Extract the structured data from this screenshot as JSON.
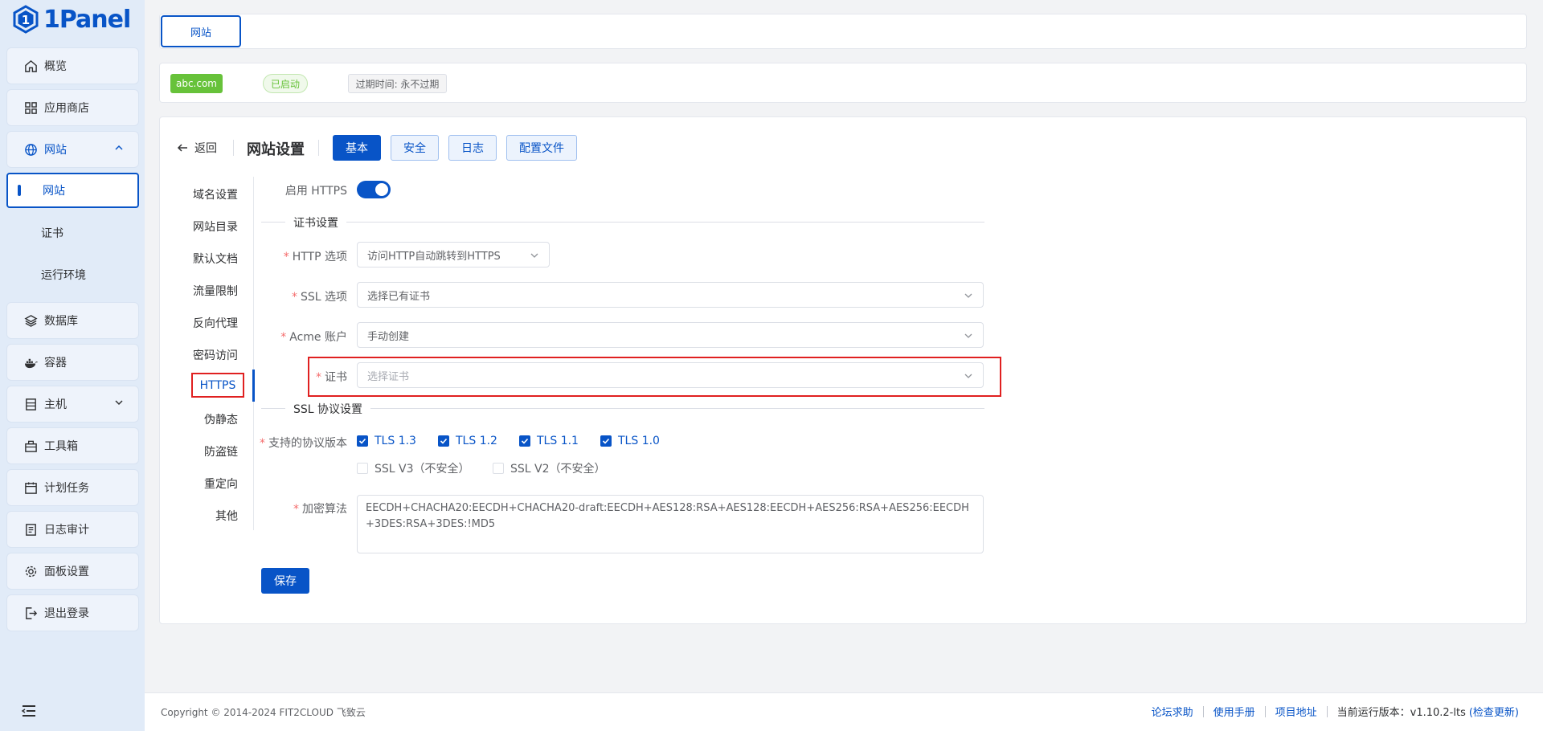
{
  "app": {
    "logo_text": "1Panel"
  },
  "sidebar": {
    "items": [
      {
        "label": "概览",
        "icon": "home-icon"
      },
      {
        "label": "应用商店",
        "icon": "apps-grid-icon"
      },
      {
        "label": "网站",
        "icon": "globe-icon",
        "expanded": true
      },
      {
        "label": "数据库",
        "icon": "layers-icon"
      },
      {
        "label": "容器",
        "icon": "docker-icon"
      },
      {
        "label": "主机",
        "icon": "server-icon",
        "expandable": true
      },
      {
        "label": "工具箱",
        "icon": "toolbox-icon"
      },
      {
        "label": "计划任务",
        "icon": "calendar-icon"
      },
      {
        "label": "日志审计",
        "icon": "log-icon"
      },
      {
        "label": "面板设置",
        "icon": "gear-icon"
      },
      {
        "label": "退出登录",
        "icon": "logout-icon"
      }
    ],
    "website_sub": [
      {
        "label": "网站",
        "selected": true
      },
      {
        "label": "证书"
      },
      {
        "label": "运行环境"
      }
    ]
  },
  "top_tab": {
    "label": "网站"
  },
  "site_info": {
    "domain": "abc.com",
    "status": "已启动",
    "expire": "过期时间: 永不过期"
  },
  "header": {
    "back_label": "返回",
    "title": "网站设置",
    "tabs": [
      "基本",
      "安全",
      "日志",
      "配置文件"
    ],
    "active_tab": "基本"
  },
  "side_menu": [
    "域名设置",
    "网站目录",
    "默认文档",
    "流量限制",
    "反向代理",
    "密码访问",
    "HTTPS",
    "伪静态",
    "防盗链",
    "重定向",
    "其他"
  ],
  "form": {
    "enable_https_label": "启用 HTTPS",
    "enable_https": true,
    "cert_section": "证书设置",
    "http_option_label": "HTTP 选项",
    "http_option_value": "访问HTTP自动跳转到HTTPS",
    "ssl_option_label": "SSL 选项",
    "ssl_option_value": "选择已有证书",
    "acme_label": "Acme 账户",
    "acme_value": "手动创建",
    "cert_label": "证书",
    "cert_placeholder": "选择证书",
    "ssl_section": "SSL 协议设置",
    "protocol_label": "支持的协议版本",
    "protocols": [
      {
        "label": "TLS 1.3",
        "checked": true
      },
      {
        "label": "TLS 1.2",
        "checked": true
      },
      {
        "label": "TLS 1.1",
        "checked": true
      },
      {
        "label": "TLS 1.0",
        "checked": true
      },
      {
        "label": "SSL V3（不安全）",
        "checked": false
      },
      {
        "label": "SSL V2（不安全）",
        "checked": false
      }
    ],
    "cipher_label": "加密算法",
    "cipher_value": "EECDH+CHACHA20:EECDH+CHACHA20-draft:EECDH+AES128:RSA+AES128:EECDH+AES256:RSA+AES256:EECDH+3DES:RSA+3DES:!MD5",
    "save_label": "保存"
  },
  "footer": {
    "copyright": "Copyright © 2014-2024 FIT2CLOUD 飞致云",
    "links": [
      "论坛求助",
      "使用手册",
      "项目地址"
    ],
    "version_prefix": "当前运行版本：v1.10.2-lts",
    "check_update": "(检查更新)"
  },
  "colors": {
    "primary": "#0854c7",
    "success": "#67c23a",
    "highlight": "#e02020",
    "sidebar_bg": "#e1ebf8"
  }
}
